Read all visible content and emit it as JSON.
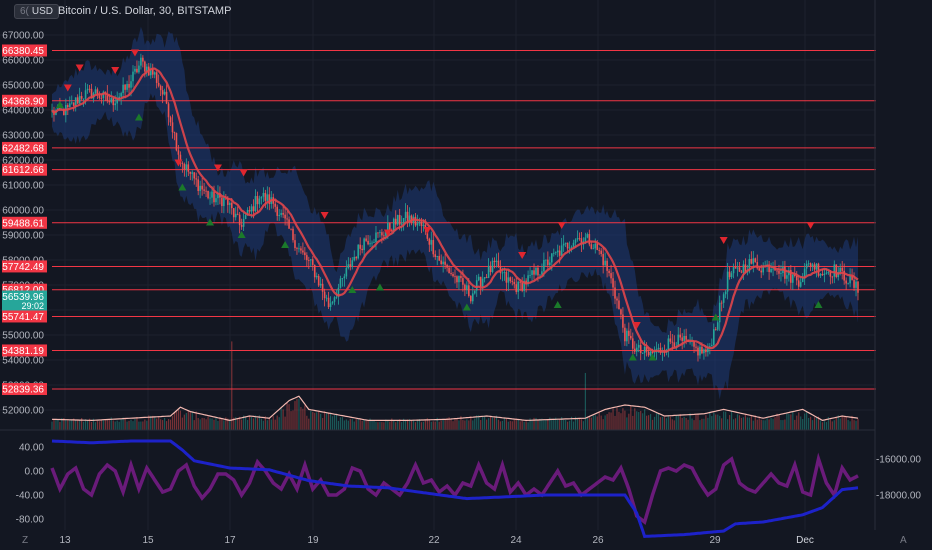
{
  "header": {
    "symbol_title": "Bitcoin / U.S. Dollar, 30, BITSTAMP",
    "currency_button": "USD",
    "currency_prefix": "6("
  },
  "price_scale": {
    "ticks": [
      "67000.00",
      "66000.00",
      "65000.00",
      "64000.00",
      "63000.00",
      "62000.00",
      "61000.00",
      "60000.00",
      "59000.00",
      "58000.00",
      "57000.00",
      "56000.00",
      "55000.00",
      "54000.00",
      "53000.00",
      "52000.00"
    ],
    "level_labels": [
      {
        "label": "66380.45",
        "value": 66380.45
      },
      {
        "label": "64368.90",
        "value": 64368.9
      },
      {
        "label": "62482.68",
        "value": 62482.68
      },
      {
        "label": "61612.66",
        "value": 61612.66
      },
      {
        "label": "59488.61",
        "value": 59488.61
      },
      {
        "label": "57742.49",
        "value": 57742.49
      },
      {
        "label": "56812.00",
        "value": 56812.0
      },
      {
        "label": "55741.47",
        "value": 55741.47
      },
      {
        "label": "54381.19",
        "value": 54381.19
      },
      {
        "label": "52839.36",
        "value": 52839.36
      }
    ],
    "current_price": "56539.96",
    "countdown": "29:02"
  },
  "oscillator_scale": {
    "left_ticks": [
      "40.00",
      "0.00",
      "-40.00",
      "-80.00"
    ],
    "right_ticks": [
      "-16000.00",
      "-18000.00"
    ]
  },
  "time_axis": {
    "labels": [
      "13",
      "15",
      "17",
      "19",
      "22",
      "24",
      "26",
      "29",
      "Dec"
    ]
  },
  "footer": {
    "left_button": "Z",
    "right_button": "A"
  },
  "colors": {
    "background": "#131722",
    "level_line": "#f23645",
    "label_bg": "#f23645",
    "current_price_bg": "#26a69a",
    "moving_average": "#e0454a",
    "band_fill": "#1e3a78",
    "up_candle": "#26a69a",
    "down_candle": "#ef5350",
    "buy_marker": "#1b7a2a",
    "sell_marker": "#e0262f",
    "volume_line": "#f4b8b0",
    "osc_purple": "#6a1b7a",
    "osc_blue": "#1d22c9"
  },
  "chart_data": {
    "type": "line",
    "price_path": [
      [
        0,
        63900
      ],
      [
        8,
        64000
      ],
      [
        15,
        64600
      ],
      [
        22,
        64700
      ],
      [
        30,
        64300
      ],
      [
        38,
        64900
      ],
      [
        45,
        65900
      ],
      [
        52,
        65400
      ],
      [
        58,
        64300
      ],
      [
        65,
        62000
      ],
      [
        72,
        61200
      ],
      [
        80,
        60500
      ],
      [
        88,
        60400
      ],
      [
        95,
        59400
      ],
      [
        100,
        59900
      ],
      [
        105,
        60600
      ],
      [
        112,
        60300
      ],
      [
        118,
        59500
      ],
      [
        126,
        58300
      ],
      [
        132,
        57700
      ],
      [
        140,
        56200
      ],
      [
        146,
        57000
      ],
      [
        152,
        58000
      ],
      [
        158,
        58800
      ],
      [
        166,
        59000
      ],
      [
        174,
        59500
      ],
      [
        180,
        59700
      ],
      [
        188,
        59300
      ],
      [
        196,
        58000
      ],
      [
        204,
        57300
      ],
      [
        212,
        56600
      ],
      [
        218,
        57300
      ],
      [
        224,
        57800
      ],
      [
        230,
        57200
      ],
      [
        236,
        56900
      ],
      [
        244,
        57400
      ],
      [
        252,
        58000
      ],
      [
        258,
        58400
      ],
      [
        265,
        58900
      ],
      [
        272,
        58800
      ],
      [
        278,
        58200
      ],
      [
        284,
        57000
      ],
      [
        290,
        55000
      ],
      [
        296,
        54400
      ],
      [
        302,
        54200
      ],
      [
        308,
        54400
      ],
      [
        314,
        54800
      ],
      [
        320,
        54700
      ],
      [
        326,
        54400
      ],
      [
        332,
        54300
      ],
      [
        337,
        55700
      ],
      [
        342,
        57300
      ],
      [
        348,
        57600
      ],
      [
        354,
        57900
      ],
      [
        360,
        57700
      ],
      [
        366,
        57800
      ],
      [
        372,
        57400
      ],
      [
        378,
        57200
      ],
      [
        384,
        57900
      ],
      [
        390,
        57500
      ],
      [
        396,
        57600
      ],
      [
        402,
        57300
      ],
      [
        408,
        56800
      ]
    ],
    "buy_signals": [
      [
        4,
        64200
      ],
      [
        44,
        63700
      ],
      [
        66,
        60900
      ],
      [
        80,
        59500
      ],
      [
        96,
        59000
      ],
      [
        118,
        58600
      ],
      [
        152,
        56800
      ],
      [
        166,
        56900
      ],
      [
        210,
        56100
      ],
      [
        256,
        56200
      ],
      [
        294,
        54100
      ],
      [
        304,
        54100
      ],
      [
        336,
        55700
      ],
      [
        388,
        56200
      ]
    ],
    "sell_signals": [
      [
        8,
        64900
      ],
      [
        14,
        65700
      ],
      [
        32,
        65600
      ],
      [
        42,
        66300
      ],
      [
        64,
        61900
      ],
      [
        84,
        61700
      ],
      [
        97,
        61500
      ],
      [
        138,
        59800
      ],
      [
        170,
        59100
      ],
      [
        190,
        59200
      ],
      [
        238,
        58200
      ],
      [
        258,
        59400
      ],
      [
        296,
        55400
      ],
      [
        340,
        58800
      ],
      [
        384,
        59400
      ]
    ],
    "volume_ma": [
      [
        0,
        0.35
      ],
      [
        20,
        0.3
      ],
      [
        40,
        0.4
      ],
      [
        60,
        0.5
      ],
      [
        65,
        0.9
      ],
      [
        70,
        0.7
      ],
      [
        90,
        0.3
      ],
      [
        100,
        0.5
      ],
      [
        110,
        0.4
      ],
      [
        120,
        1.2
      ],
      [
        125,
        1.4
      ],
      [
        130,
        0.8
      ],
      [
        160,
        0.3
      ],
      [
        180,
        0.3
      ],
      [
        200,
        0.35
      ],
      [
        220,
        0.5
      ],
      [
        240,
        0.3
      ],
      [
        270,
        0.4
      ],
      [
        280,
        0.8
      ],
      [
        290,
        1.0
      ],
      [
        300,
        0.9
      ],
      [
        310,
        0.5
      ],
      [
        330,
        0.6
      ],
      [
        340,
        0.8
      ],
      [
        360,
        0.4
      ],
      [
        380,
        0.8
      ],
      [
        390,
        0.3
      ],
      [
        400,
        0.5
      ],
      [
        408,
        0.4
      ]
    ],
    "osc_purple": [
      [
        0,
        5
      ],
      [
        4,
        -30
      ],
      [
        8,
        -5
      ],
      [
        12,
        5
      ],
      [
        16,
        -30
      ],
      [
        20,
        -40
      ],
      [
        24,
        -5
      ],
      [
        28,
        10
      ],
      [
        32,
        0
      ],
      [
        36,
        -35
      ],
      [
        40,
        10
      ],
      [
        44,
        -30
      ],
      [
        48,
        5
      ],
      [
        52,
        -15
      ],
      [
        56,
        -35
      ],
      [
        60,
        -30
      ],
      [
        64,
        0
      ],
      [
        68,
        10
      ],
      [
        72,
        -25
      ],
      [
        76,
        -45
      ],
      [
        80,
        -30
      ],
      [
        84,
        -5
      ],
      [
        88,
        -5
      ],
      [
        92,
        -15
      ],
      [
        96,
        -40
      ],
      [
        100,
        -20
      ],
      [
        104,
        15
      ],
      [
        108,
        0
      ],
      [
        112,
        -20
      ],
      [
        116,
        -30
      ],
      [
        120,
        -5
      ],
      [
        124,
        -30
      ],
      [
        128,
        10
      ],
      [
        132,
        -30
      ],
      [
        136,
        -15
      ],
      [
        140,
        -40
      ],
      [
        144,
        -40
      ],
      [
        148,
        -30
      ],
      [
        152,
        5
      ],
      [
        156,
        0
      ],
      [
        160,
        -30
      ],
      [
        164,
        -40
      ],
      [
        168,
        -20
      ],
      [
        172,
        -30
      ],
      [
        176,
        -40
      ],
      [
        180,
        -20
      ],
      [
        184,
        10
      ],
      [
        188,
        -20
      ],
      [
        192,
        -15
      ],
      [
        196,
        -35
      ],
      [
        200,
        -25
      ],
      [
        204,
        -40
      ],
      [
        208,
        -20
      ],
      [
        212,
        -25
      ],
      [
        216,
        10
      ],
      [
        220,
        -20
      ],
      [
        224,
        -30
      ],
      [
        228,
        10
      ],
      [
        232,
        -35
      ],
      [
        236,
        -20
      ],
      [
        240,
        -40
      ],
      [
        244,
        -30
      ],
      [
        248,
        -40
      ],
      [
        252,
        -20
      ],
      [
        256,
        0
      ],
      [
        260,
        -25
      ],
      [
        264,
        -20
      ],
      [
        268,
        -40
      ],
      [
        272,
        -30
      ],
      [
        276,
        -20
      ],
      [
        280,
        -10
      ],
      [
        284,
        -15
      ],
      [
        288,
        5
      ],
      [
        292,
        -30
      ],
      [
        296,
        -75
      ],
      [
        300,
        -85
      ],
      [
        304,
        -40
      ],
      [
        308,
        0
      ],
      [
        312,
        5
      ],
      [
        316,
        0
      ],
      [
        320,
        10
      ],
      [
        324,
        5
      ],
      [
        328,
        -20
      ],
      [
        332,
        -40
      ],
      [
        336,
        -30
      ],
      [
        340,
        10
      ],
      [
        344,
        20
      ],
      [
        348,
        -20
      ],
      [
        352,
        -30
      ],
      [
        356,
        -35
      ],
      [
        360,
        -20
      ],
      [
        364,
        -5
      ],
      [
        368,
        -20
      ],
      [
        372,
        -25
      ],
      [
        376,
        10
      ],
      [
        380,
        -35
      ],
      [
        384,
        -40
      ],
      [
        388,
        20
      ],
      [
        392,
        -20
      ],
      [
        396,
        -40
      ],
      [
        400,
        5
      ],
      [
        404,
        -15
      ],
      [
        408,
        -8
      ]
    ],
    "osc_blue": [
      [
        0,
        -15000
      ],
      [
        20,
        -15100
      ],
      [
        40,
        -15000
      ],
      [
        60,
        -15000
      ],
      [
        66,
        -15500
      ],
      [
        72,
        -16100
      ],
      [
        90,
        -16500
      ],
      [
        110,
        -16600
      ],
      [
        130,
        -17200
      ],
      [
        150,
        -17500
      ],
      [
        170,
        -17600
      ],
      [
        190,
        -17900
      ],
      [
        210,
        -18200
      ],
      [
        230,
        -18100
      ],
      [
        250,
        -18000
      ],
      [
        270,
        -18000
      ],
      [
        290,
        -18000
      ],
      [
        296,
        -19000
      ],
      [
        300,
        -20300
      ],
      [
        320,
        -20200
      ],
      [
        340,
        -20000
      ],
      [
        346,
        -19600
      ],
      [
        360,
        -19500
      ],
      [
        380,
        -19100
      ],
      [
        390,
        -18700
      ],
      [
        400,
        -17700
      ],
      [
        408,
        -17600
      ]
    ],
    "osc_left_range": [
      -95,
      55
    ],
    "osc_right_range": [
      -21000,
      -14500
    ],
    "price_range": [
      51000,
      67500
    ],
    "bar_count": 409
  }
}
